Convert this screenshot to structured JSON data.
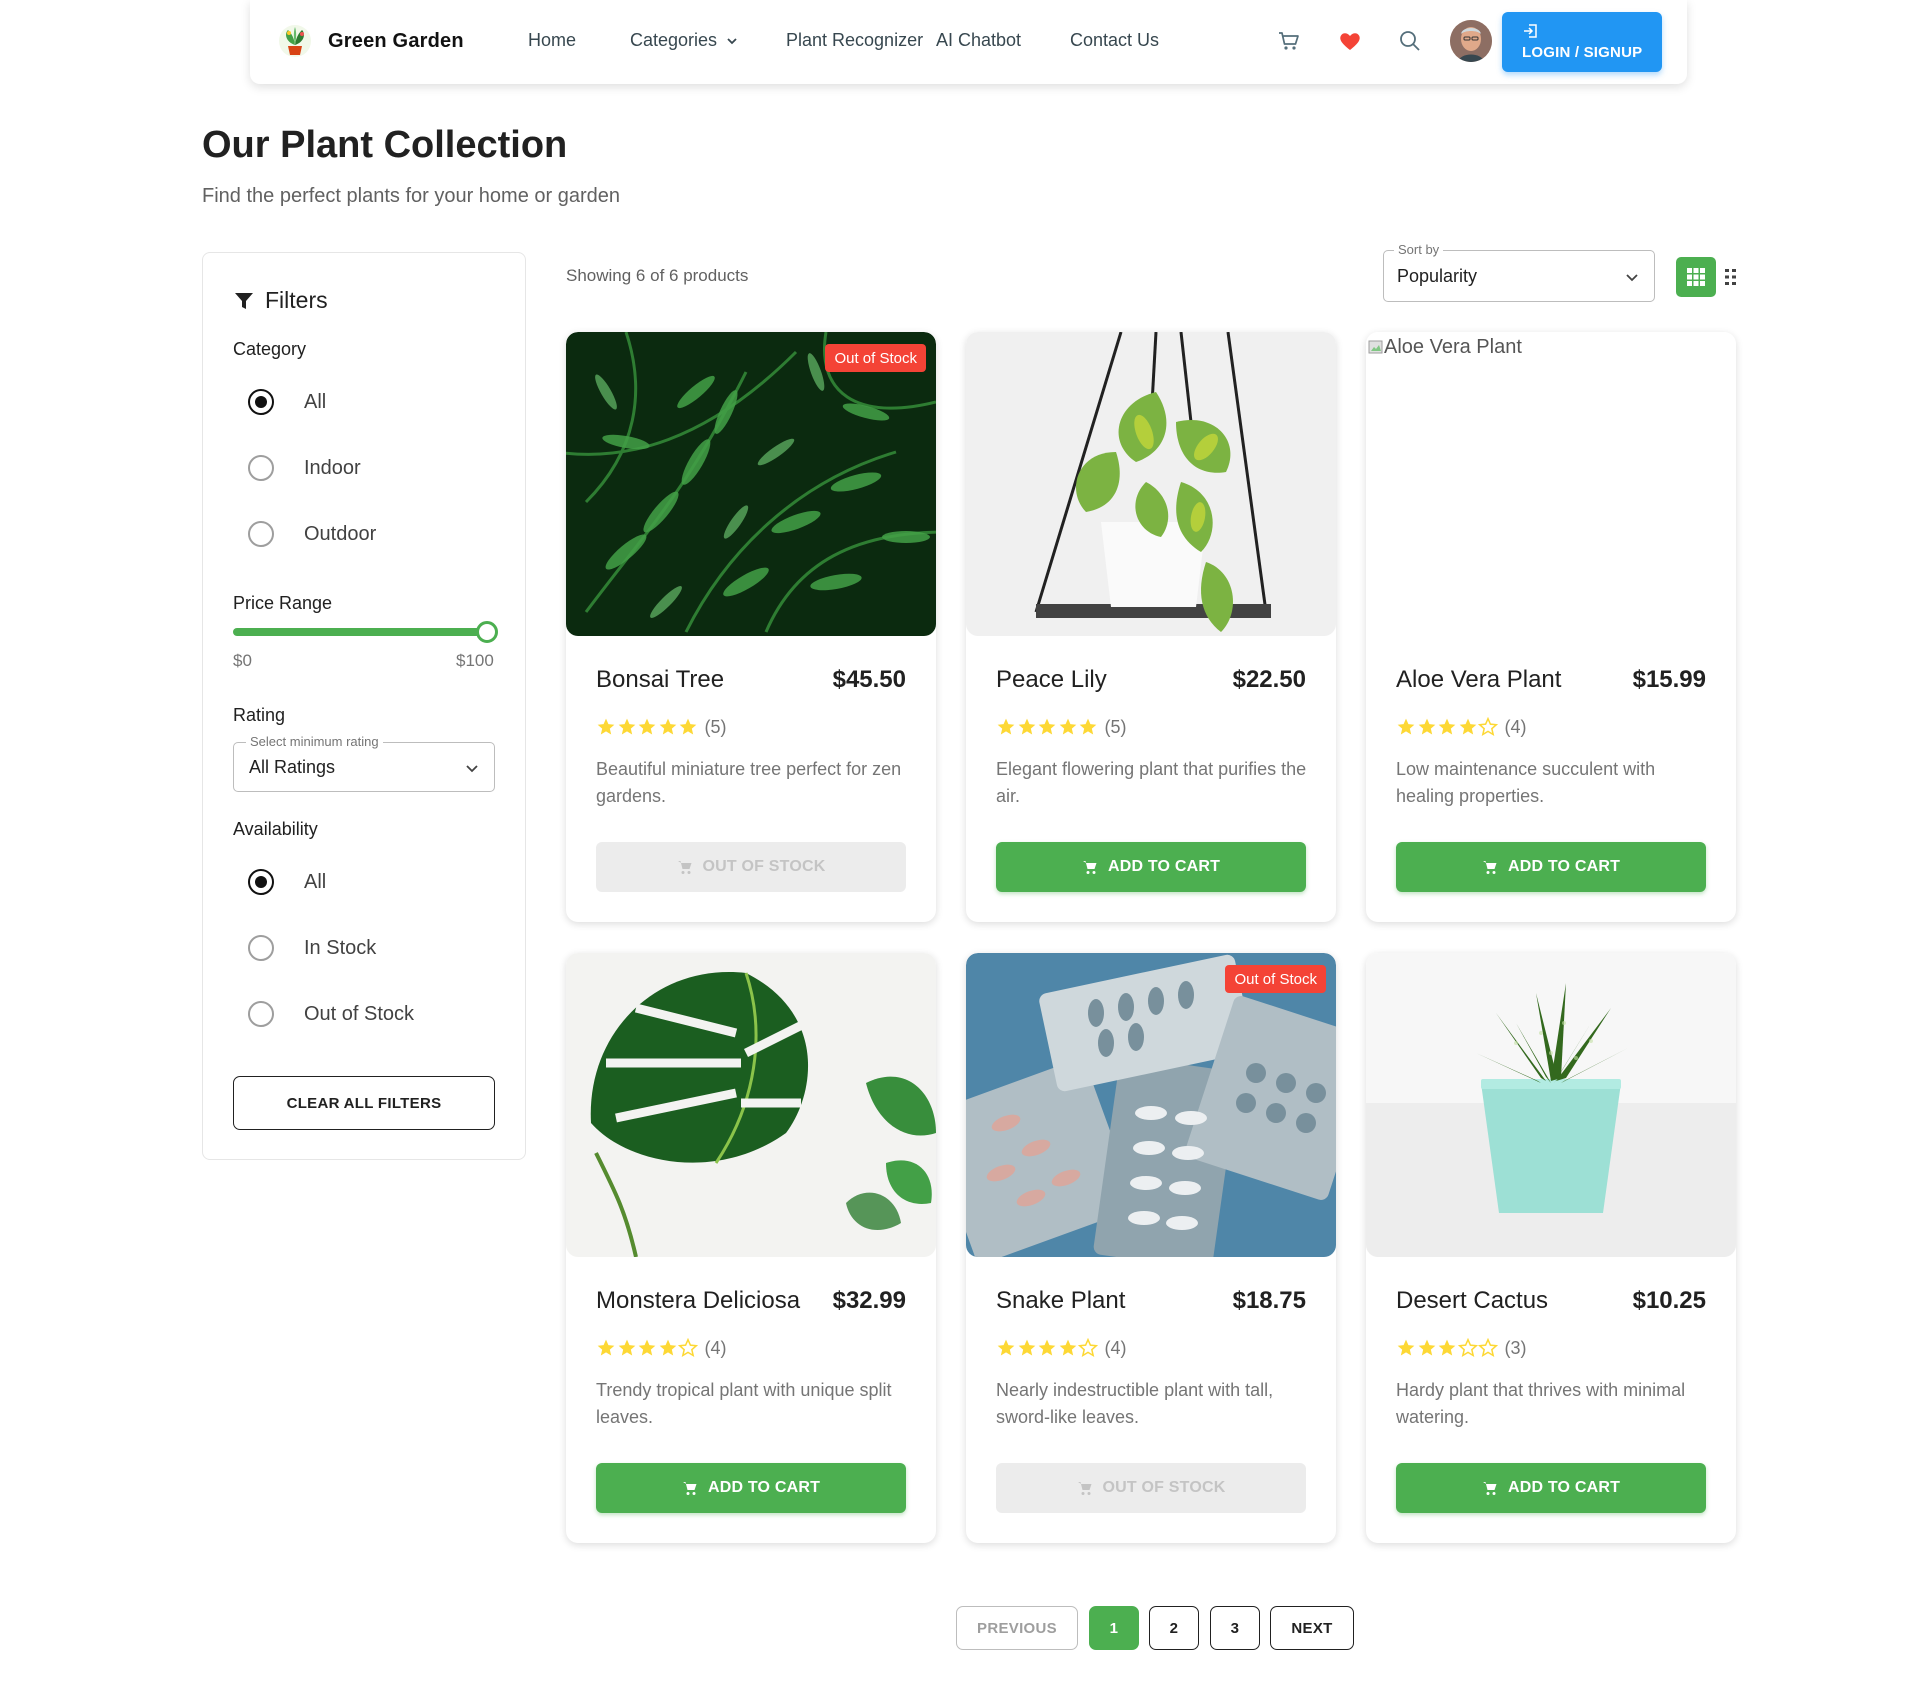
{
  "navbar": {
    "brand": "Green Garden",
    "links": [
      {
        "label": "Home"
      },
      {
        "label": "Categories"
      },
      {
        "label": "Plant Recognizer"
      },
      {
        "label": "AI Chatbot"
      },
      {
        "label": "Contact Us"
      }
    ],
    "login_label": "LOGIN / SIGNUP",
    "icons": [
      "cart-icon",
      "heart-icon",
      "search-icon"
    ],
    "accent_color": "#2196f3"
  },
  "header": {
    "title": "Our Plant Collection",
    "subtitle": "Find the perfect plants for your home or garden"
  },
  "filters": {
    "title": "Filters",
    "category": {
      "label": "Category",
      "options": [
        "All",
        "Indoor",
        "Outdoor"
      ],
      "selected": "All"
    },
    "price": {
      "label": "Price Range",
      "min_label": "$0",
      "max_label": "$100",
      "value_fraction": 1.0
    },
    "rating": {
      "label": "Rating",
      "legend": "Select minimum rating",
      "value": "All Ratings"
    },
    "availability": {
      "label": "Availability",
      "options": [
        "All",
        "In Stock",
        "Out of Stock"
      ],
      "selected": "All"
    },
    "clear_label": "CLEAR ALL FILTERS"
  },
  "toolbar": {
    "showing": "Showing 6 of 6 products",
    "sort_legend": "Sort by",
    "sort_value": "Popularity"
  },
  "products": [
    {
      "name": "Bonsai Tree",
      "price": "$45.50",
      "rating": 5,
      "count": "(5)",
      "description": "Beautiful miniature tree perfect for zen gardens.",
      "badge": "Out of Stock",
      "button": "OUT OF STOCK",
      "in_stock": false,
      "image": "fern"
    },
    {
      "name": "Peace Lily",
      "price": "$22.50",
      "rating": 5,
      "count": "(5)",
      "description": "Elegant flowering plant that purifies the air.",
      "badge": "",
      "button": "ADD TO CART",
      "in_stock": true,
      "image": "hanging-pothos"
    },
    {
      "name": "Aloe Vera Plant",
      "price": "$15.99",
      "rating": 4,
      "count": "(4)",
      "description": "Low maintenance succulent with healing properties.",
      "badge": "",
      "button": "ADD TO CART",
      "in_stock": true,
      "image": "broken",
      "image_alt": "Aloe Vera Plant"
    },
    {
      "name": "Monstera Deliciosa",
      "price": "$32.99",
      "rating": 4,
      "count": "(4)",
      "description": "Trendy tropical plant with unique split leaves.",
      "badge": "",
      "button": "ADD TO CART",
      "in_stock": true,
      "image": "monstera"
    },
    {
      "name": "Snake Plant",
      "price": "$18.75",
      "rating": 4,
      "count": "(4)",
      "description": "Nearly indestructible plant with tall, sword-like leaves.",
      "badge": "Out of Stock",
      "button": "OUT OF STOCK",
      "in_stock": false,
      "image": "pills"
    },
    {
      "name": "Desert Cactus",
      "price": "$10.25",
      "rating": 3,
      "count": "(3)",
      "description": "Hardy plant that thrives with minimal watering.",
      "badge": "",
      "button": "ADD TO CART",
      "in_stock": true,
      "image": "succulent"
    }
  ],
  "pagination": {
    "previous": "PREVIOUS",
    "pages": [
      "1",
      "2",
      "3"
    ],
    "current": "1",
    "next": "NEXT"
  },
  "colors": {
    "primary_green": "#4caf50",
    "badge_red": "#f44336",
    "star_yellow": "#fdd835"
  }
}
